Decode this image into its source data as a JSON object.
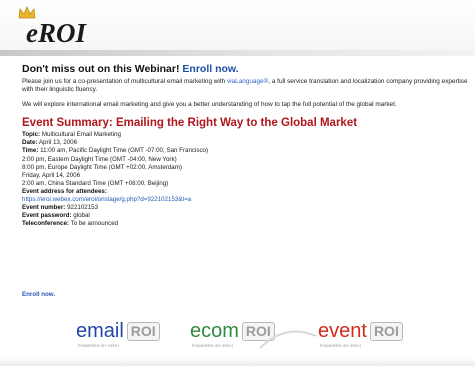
{
  "header": {
    "logo_text": "eROI"
  },
  "headline": {
    "text": "Don't miss out on this Webinar!",
    "enroll_link": "Enroll now."
  },
  "intro": {
    "part1": "Please join us for a co-presentation of multicultural email marketing with",
    "link": "viaLanguage®",
    "part2": ", a full service translation and localization company providing expertise with their linguistic fluency.",
    "paragraph2": "We will explore international email marketing and give you a better understanding of how to tap the full potential of the global market."
  },
  "event": {
    "title": "Event Summary: Emailing the Right Way to the Global Market",
    "topic_label": "Topic:",
    "topic_value": "Multicultural Email Marketing",
    "date_label": "Date:",
    "date_value": "April 13, 2006",
    "time_label": "Time:",
    "time_value": "11:00 am, Pacific Daylight Time (GMT -07:00, San Francisco)",
    "time_line2": "2:00 pm, Eastern Daylight Time (GMT -04:00, New York)",
    "time_line3": "8:00 pm, Europe Daylight Time (GMT +02:00, Amsterdam)",
    "time_line4": "Friday, April 14, 2006",
    "time_line5": "2:00 am, China Standard Time (GMT +08:00, Beijing)",
    "address_label": "Event address for attendees:",
    "address_url": "https://eroi.webex.com/eroi/onstage/g.php?d=922102153&t=a",
    "number_label": "Event number:",
    "number_value": "922102153",
    "password_label": "Event password:",
    "password_value": "global",
    "teleconference_label": "Teleconference:",
    "teleconference_value": "To be announced"
  },
  "enroll_small": "Enroll now.",
  "footer_brands": [
    {
      "word": "email",
      "box": "ROI",
      "powered": "POWERED BY EROI",
      "color": "#2346a8"
    },
    {
      "word": "ecom",
      "box": "ROI",
      "powered": "POWERED BY EROI",
      "color": "#2e8a3c"
    },
    {
      "word": "event",
      "box": "ROI",
      "powered": "POWERED BY EROI",
      "color": "#d22a1e"
    }
  ]
}
